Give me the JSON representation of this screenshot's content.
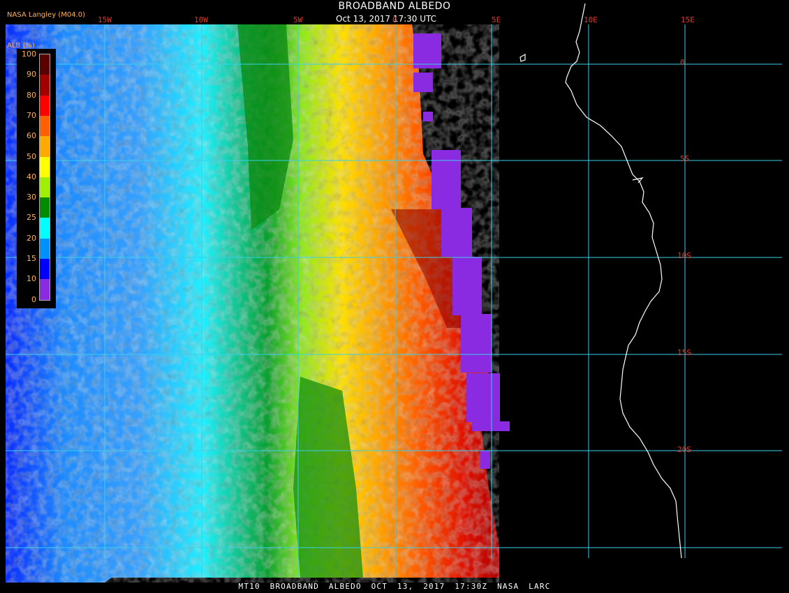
{
  "title": "BROADBAND ALBEDO",
  "subtitle": "Oct 13, 2017 17:30 UTC",
  "credit": "NASA Langley (M04.0)",
  "footer": "MT10 BROADBAND ALBEDO OCT 13, 2017 17:30Z NASA LARC",
  "legend": {
    "title": "ALB (%)",
    "ticks": [
      "100",
      "90",
      "80",
      "70",
      "60",
      "50",
      "40",
      "30",
      "25",
      "20",
      "15",
      "10",
      "0"
    ],
    "colors": [
      "#5a0000",
      "#a00000",
      "#ff0000",
      "#ff6000",
      "#ffaa00",
      "#ffff00",
      "#9ef000",
      "#008c00",
      "#00ffff",
      "#0090ff",
      "#0000ff",
      "#8a2be2"
    ]
  },
  "lon_labels": [
    "15W",
    "10W",
    "5W",
    "0",
    "5E",
    "10E",
    "15E"
  ],
  "lat_labels": [
    "0",
    "5S",
    "10S",
    "15S",
    "20S"
  ],
  "colors": {
    "grid": "#3ad0e8",
    "coast": "#ffffff",
    "label": "#e23a2a",
    "legend_text": "#ffb25a",
    "space_off_disk": "#8a2be2"
  }
}
